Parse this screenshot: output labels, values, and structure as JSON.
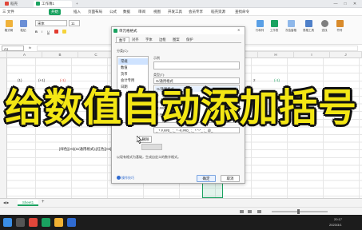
{
  "titlebar": {
    "tabs": [
      {
        "label": "稻壳",
        "color": "#e0463a"
      },
      {
        "label": "工作簿1",
        "color": "#1aa260"
      }
    ],
    "new_tab": "+",
    "controls": {
      "minimize": "—",
      "maximize": "□",
      "close": "✕"
    }
  },
  "menubar": {
    "items": [
      "三 文件",
      "开始",
      "插入",
      "页面布局",
      "公式",
      "数据",
      "审阅",
      "视图",
      "开发工具",
      "会员专享",
      "稻壳资源",
      "查找命令"
    ],
    "active_index": 1
  },
  "ribbon": {
    "left": [
      "格式刷",
      "粘贴"
    ],
    "right": [
      "行和列",
      "工作表",
      "冻结窗格",
      "表格工具",
      "查找",
      "符号"
    ],
    "font_name": "宋体",
    "font_size": "11"
  },
  "formula": {
    "cell_ref": "A1",
    "fx": "fx"
  },
  "columns": [
    "A",
    "B",
    "C",
    "D",
    "E",
    "F",
    "G",
    "H",
    "I",
    "J"
  ],
  "cells": {
    "r1": [
      "(1)",
      "(+1)",
      "(-1)"
    ],
    "r1_right": [
      "2",
      "(-1)"
    ],
    "format_code": "[绿色][>0](G/通用格式);[红色][<0](G/通用格式);(0)"
  },
  "sheet": {
    "tab": "Sheet1",
    "add": "+"
  },
  "dialog": {
    "title": "单元格格式",
    "tabs": [
      "数字",
      "对齐",
      "字体",
      "边框",
      "图案",
      "保护"
    ],
    "active_tab": 0,
    "category_label": "分类(C):",
    "categories": [
      "常规",
      "数值",
      "货币",
      "会计专用",
      "日期"
    ],
    "selected_category": 0,
    "sample_label": "示例",
    "type_label": "类型(T):",
    "type_value": "G/通用格式",
    "type_options": [
      "G/通用格式",
      "0",
      "0.00",
      "#,##0",
      "#,##0.00",
      "_ * #,##0_ ;_ * -#,##0_ ;_ * \"-\"_ ;_ @_"
    ],
    "delete_button": "删除(D)",
    "hint": "以现有格式为基础，生成自定义的数字格式。",
    "tips_link": "操作技巧",
    "ok": "确定",
    "cancel": "取消"
  },
  "caption": "给数值自动添加括号",
  "taskbar": {
    "time": "20:17",
    "date": "2023/3/1"
  }
}
